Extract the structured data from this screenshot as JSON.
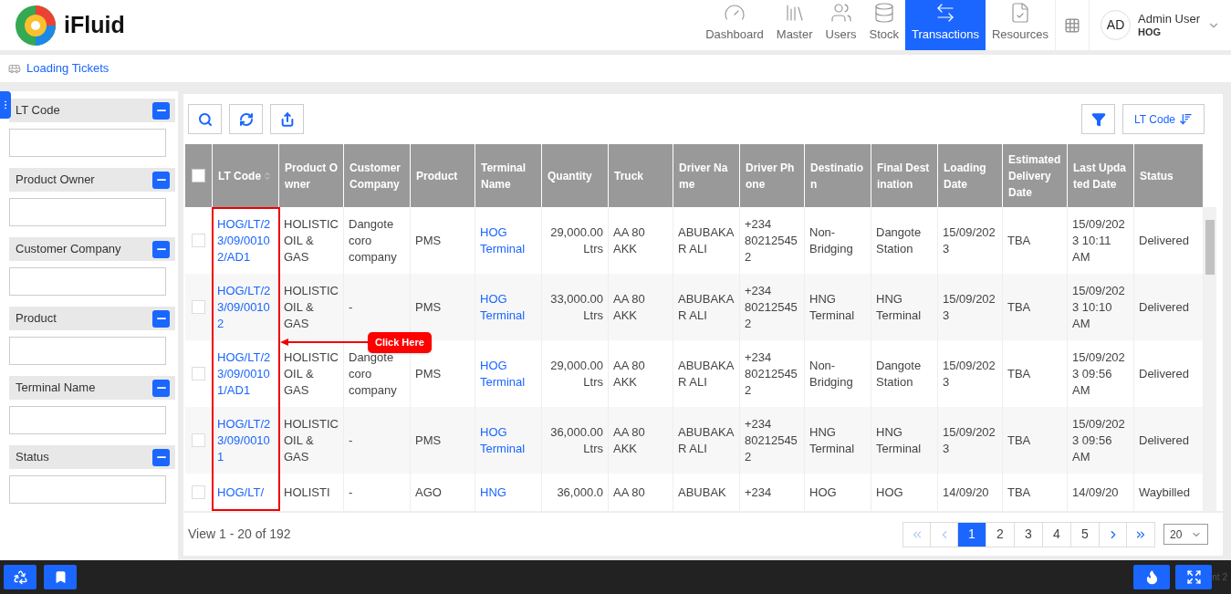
{
  "app": {
    "name": "iFluid"
  },
  "nav": [
    {
      "label": "Dashboard",
      "selected": false
    },
    {
      "label": "Master",
      "selected": false
    },
    {
      "label": "Users",
      "selected": false
    },
    {
      "label": "Stock",
      "selected": false
    },
    {
      "label": "Transactions",
      "selected": true
    },
    {
      "label": "Resources",
      "selected": false
    }
  ],
  "user": {
    "initials": "AD",
    "name": "Admin User",
    "org": "HOG"
  },
  "breadcrumb": "Loading Tickets",
  "filters": [
    {
      "label": "LT Code"
    },
    {
      "label": "Product Owner"
    },
    {
      "label": "Customer Company"
    },
    {
      "label": "Product"
    },
    {
      "label": "Terminal Name"
    },
    {
      "label": "Status"
    }
  ],
  "sort_button": "LT Code",
  "table": {
    "all_checked": false,
    "columns": [
      {
        "label": "LT Code",
        "kind": "link"
      },
      {
        "label": "Product Owner",
        "kind": "text"
      },
      {
        "label": "Customer Company",
        "kind": "text"
      },
      {
        "label": "Product",
        "kind": "text"
      },
      {
        "label": "Terminal Name",
        "kind": "link"
      },
      {
        "label": "Quantity",
        "kind": "number"
      },
      {
        "label": "Truck",
        "kind": "text"
      },
      {
        "label": "Driver Name",
        "kind": "text"
      },
      {
        "label": "Driver Phone",
        "kind": "text"
      },
      {
        "label": "Destination",
        "kind": "text"
      },
      {
        "label": "Final Destination",
        "kind": "text"
      },
      {
        "label": "Loading Date",
        "kind": "text"
      },
      {
        "label": "Estimated Delivery Date",
        "kind": "text"
      },
      {
        "label": "Last Updated Date",
        "kind": "text"
      },
      {
        "label": "Status",
        "kind": "text"
      }
    ],
    "rows": [
      {
        "checked": false,
        "cells": [
          "HOG/LT/23/09/00102/AD1",
          "HOLISTIC OIL & GAS",
          "Dangote coro company",
          "PMS",
          "HOG Terminal",
          "29,000.00 Ltrs",
          "AA 80 AKK",
          "ABUBAKAR ALI",
          "+234 802125452",
          "Non-Bridging",
          "Dangote Station",
          "15/09/2023",
          "TBA",
          "15/09/2023 10:11 AM",
          "Delivered"
        ]
      },
      {
        "checked": false,
        "cells": [
          "HOG/LT/23/09/00102",
          "HOLISTIC OIL & GAS",
          "-",
          "PMS",
          "HOG Terminal",
          "33,000.00 Ltrs",
          "AA 80 AKK",
          "ABUBAKAR ALI",
          "+234 802125452",
          "HNG Terminal",
          "HNG Terminal",
          "15/09/2023",
          "TBA",
          "15/09/2023 10:10 AM",
          "Delivered"
        ]
      },
      {
        "checked": false,
        "cells": [
          "HOG/LT/23/09/00101/AD1",
          "HOLISTIC OIL & GAS",
          "Dangote coro company",
          "PMS",
          "HOG Terminal",
          "29,000.00 Ltrs",
          "AA 80 AKK",
          "ABUBAKAR ALI",
          "+234 802125452",
          "Non-Bridging",
          "Dangote Station",
          "15/09/2023",
          "TBA",
          "15/09/2023 09:56 AM",
          "Delivered"
        ]
      },
      {
        "checked": false,
        "cells": [
          "HOG/LT/23/09/00101",
          "HOLISTIC OIL & GAS",
          "-",
          "PMS",
          "HOG Terminal",
          "36,000.00 Ltrs",
          "AA 80 AKK",
          "ABUBAKAR ALI",
          "+234 802125452",
          "HNG Terminal",
          "HNG Terminal",
          "15/09/2023",
          "TBA",
          "15/09/2023 09:56 AM",
          "Delivered"
        ]
      },
      {
        "checked": false,
        "cells": [
          "HOG/LT/",
          "HOLISTI",
          "-",
          "AGO",
          "HNG",
          "36,000.0",
          "AA 80",
          "ABUBAK",
          "+234",
          "HOG",
          "HOG",
          "14/09/20",
          "TBA",
          "14/09/20",
          "Waybilled"
        ]
      }
    ]
  },
  "callout": "Click Here",
  "pager": {
    "summary": "View 1 - 20 of 192",
    "pages": [
      {
        "label": "1",
        "selected": true
      },
      {
        "label": "2",
        "selected": false
      },
      {
        "label": "3",
        "selected": false
      },
      {
        "label": "4",
        "selected": false
      },
      {
        "label": "5",
        "selected": false
      }
    ],
    "first_disabled": true,
    "prev_disabled": true,
    "next_disabled": false,
    "last_disabled": false,
    "page_size": "20"
  },
  "footer_text": "nt 2"
}
